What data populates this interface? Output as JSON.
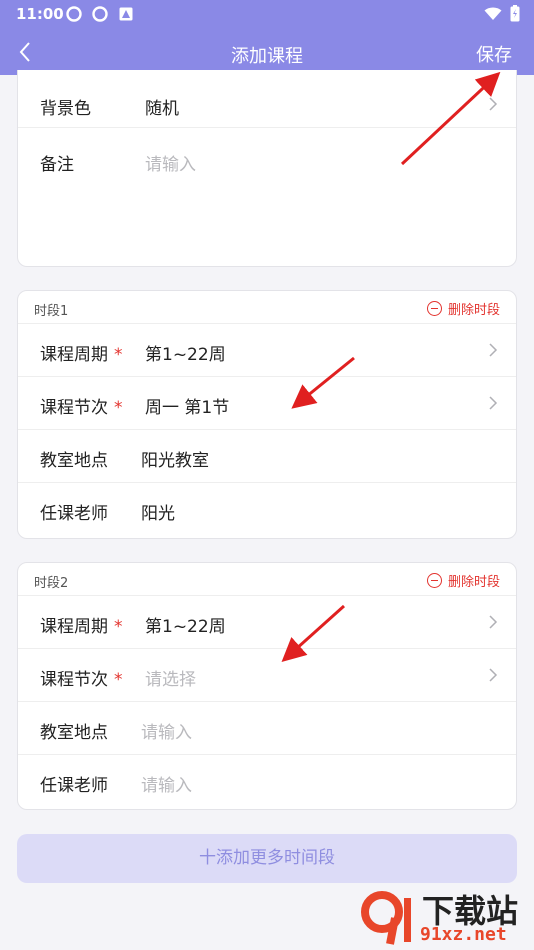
{
  "status_bar": {
    "time": "11:00"
  },
  "header": {
    "title": "添加课程",
    "save_label": "保存"
  },
  "card_top": {
    "rows": [
      {
        "label": "背景色",
        "value": "随机"
      },
      {
        "label": "备注",
        "placeholder": "请输入"
      }
    ]
  },
  "segments": [
    {
      "title": "时段1",
      "delete_label": "删除时段",
      "rows": [
        {
          "label": "课程周期",
          "required": "*",
          "value": "第1~22周"
        },
        {
          "label": "课程节次",
          "required": "*",
          "value": "周一 第1节"
        },
        {
          "label": "教室地点",
          "value": "阳光教室"
        },
        {
          "label": "任课老师",
          "value": "阳光"
        }
      ]
    },
    {
      "title": "时段2",
      "delete_label": "删除时段",
      "rows": [
        {
          "label": "课程周期",
          "required": "*",
          "value": "第1~22周"
        },
        {
          "label": "课程节次",
          "required": "*",
          "placeholder": "请选择"
        },
        {
          "label": "教室地点",
          "placeholder": "请输入"
        },
        {
          "label": "任课老师",
          "placeholder": "请输入"
        }
      ]
    }
  ],
  "add_more_label": "十添加更多时间段",
  "watermark": {
    "text": "下载站",
    "url_text": "91xz.net"
  },
  "colors": {
    "header": "#8a89e6",
    "accent": "#e3342f",
    "add_button_bg": "#dcdbf7"
  }
}
